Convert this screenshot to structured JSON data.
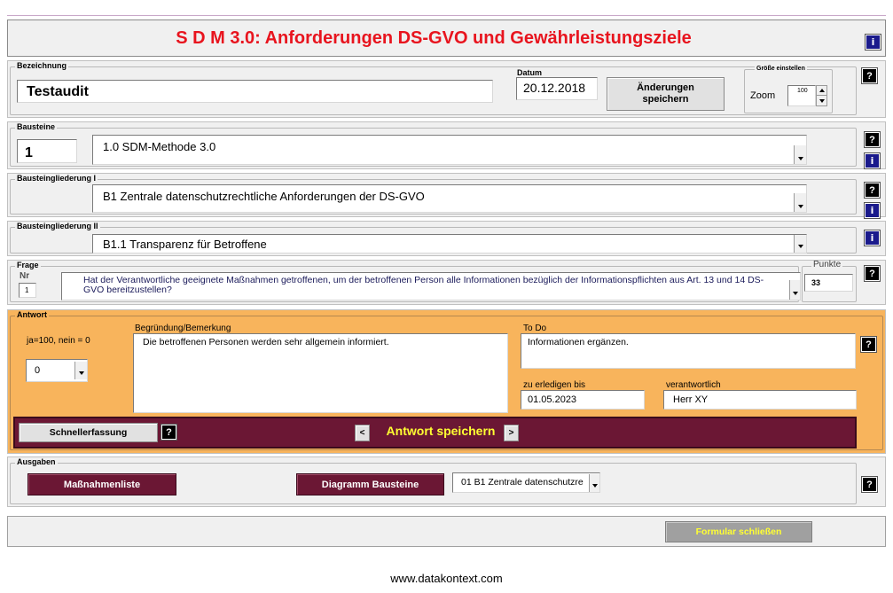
{
  "title": "S D M 3.0: Anforderungen DS-GVO und Gewährleistungsziele",
  "icons": {
    "help": "?",
    "info": "i"
  },
  "bezeichnung": {
    "legend": "Bezeichnung",
    "value": "Testaudit"
  },
  "datum": {
    "label": "Datum",
    "value": "20.12.2018"
  },
  "save_changes": "Änderungen speichern",
  "zoom": {
    "legend": "Größe einstellen",
    "label": "Zoom",
    "value": "100"
  },
  "bausteine": {
    "legend": "Bausteine",
    "number": "1",
    "selected": "1.0 SDM-Methode 3.0"
  },
  "gliederung1": {
    "legend": "Bausteingliederung I",
    "selected": "B1 Zentrale datenschutzrechtliche Anforderungen der DS-GVO"
  },
  "gliederung2": {
    "legend": "Bausteingliederung II",
    "selected": "B1.1 Transparenz für Betroffene"
  },
  "frage": {
    "legend": "Frage",
    "nr_label": "Nr",
    "nr": "1",
    "text": "Hat der Verantwortliche geeignete Maßnahmen getroffenen, um der betroffenen Person alle Informationen bezüglich der Informationspflichten aus Art. 13 und 14 DS-GVO bereitzustellen?"
  },
  "punkte": {
    "legend": "Punkte",
    "value": "33"
  },
  "antwort": {
    "legend": "Antwort",
    "scale_label": "ja=100, nein = 0",
    "score": "0",
    "begruendung_label": "Begründung/Bemerkung",
    "begruendung": "Die betroffenen Personen werden sehr allgemein informiert.",
    "todo_label": "To Do",
    "todo": "Informationen ergänzen.",
    "due_label": "zu erledigen bis",
    "due": "01.05.2023",
    "resp_label": "verantwortlich",
    "resp": "Herr XY"
  },
  "nav": {
    "quick": "Schnellerfassung",
    "prev": "<",
    "save": "Antwort speichern",
    "next": ">"
  },
  "ausgaben": {
    "legend": "Ausgaben",
    "massnahmen": "Maßnahmenliste",
    "diagramm": "Diagramm Bausteine",
    "selected": "01 B1 Zentrale datenschutzre"
  },
  "close": "Formular schließen",
  "footer": "www.datakontext.com",
  "colors": {
    "title": "#e8141e",
    "antwort_bg": "#f8b45c",
    "maroon": "#6b1734",
    "save_text": "#ffff32"
  }
}
